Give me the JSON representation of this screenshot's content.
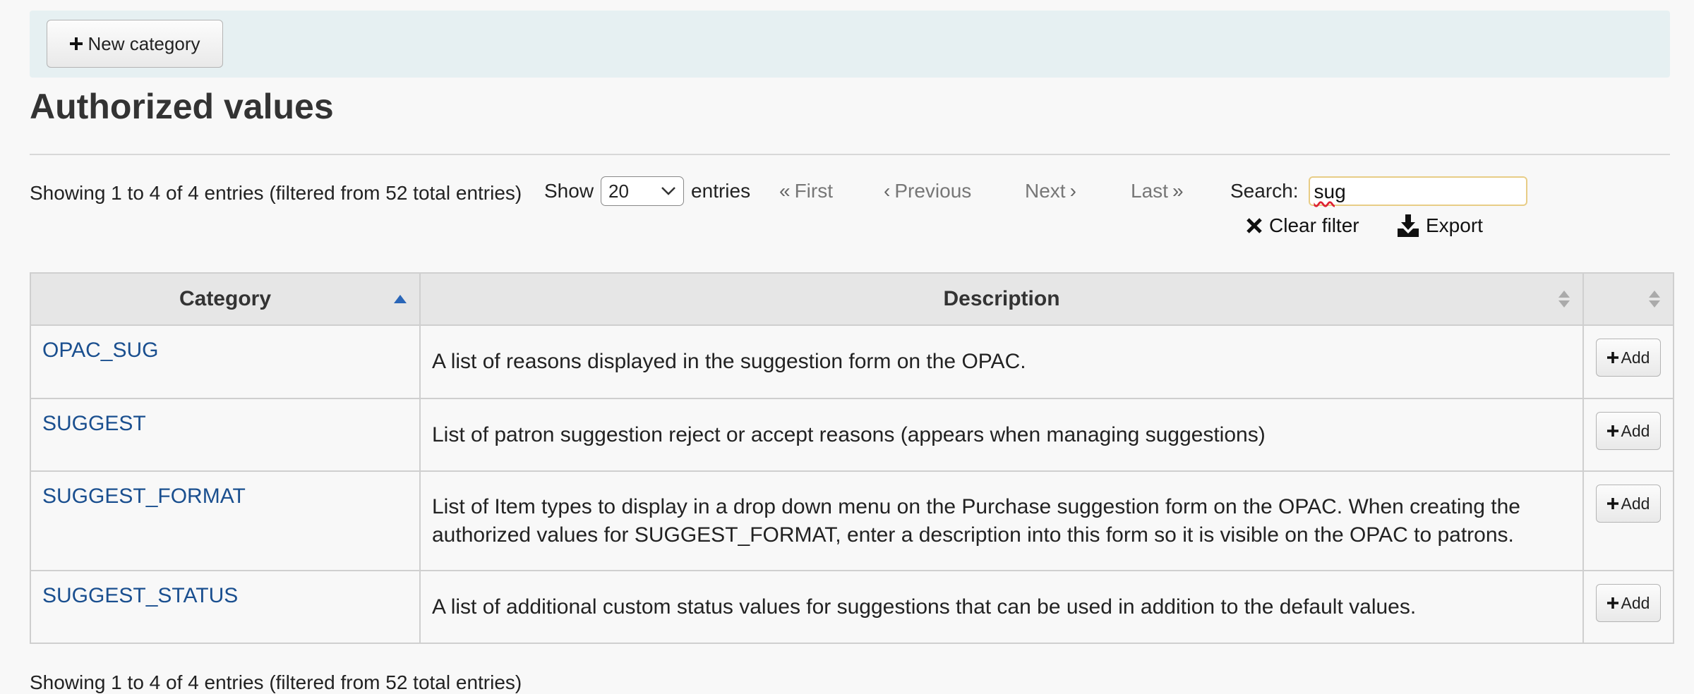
{
  "toolbar": {
    "new_category_label": "New category"
  },
  "page": {
    "title": "Authorized values"
  },
  "table_info": "Showing 1 to 4 of 4 entries (filtered from 52 total entries)",
  "length_menu": {
    "show_label": "Show",
    "selected": "20",
    "entries_label": "entries"
  },
  "pager": {
    "first": "First",
    "previous": "Previous",
    "next": "Next",
    "last": "Last"
  },
  "search": {
    "label": "Search:",
    "value": "sug"
  },
  "actions": {
    "clear_filter": "Clear filter",
    "export": "Export"
  },
  "table": {
    "columns": [
      "Category",
      "Description",
      ""
    ],
    "rows": [
      {
        "category": "OPAC_SUG",
        "description": "A list of reasons displayed in the suggestion form on the OPAC.",
        "action": "Add"
      },
      {
        "category": "SUGGEST",
        "description": "List of patron suggestion reject or accept reasons (appears when managing suggestions)",
        "action": "Add"
      },
      {
        "category": "SUGGEST_FORMAT",
        "description": "List of Item types to display in a drop down menu on the Purchase suggestion form on the OPAC. When creating the authorized values for SUGGEST_FORMAT, enter a description into this form so it is visible on the OPAC to patrons.",
        "action": "Add"
      },
      {
        "category": "SUGGEST_STATUS",
        "description": "A list of additional custom status values for suggestions that can be used in addition to the default values.",
        "action": "Add"
      }
    ]
  },
  "colors": {
    "link": "#1a4f8f",
    "toolbar_bg": "#e6f0f2",
    "search_border": "#e8cd86"
  }
}
